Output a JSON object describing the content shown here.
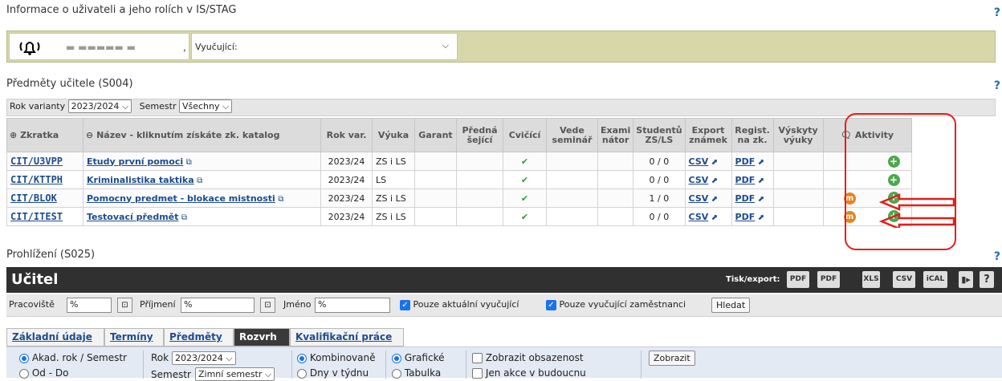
{
  "header": {
    "title": "Informace o uživateli a jeho rolích v IS/STAG",
    "user_name": "▬ ▬▬▬▬▬ ▬",
    "role_value": "Vyučující:"
  },
  "subjects": {
    "title": "Předměty učitele (S004)",
    "filters": {
      "year_label": "Rok varianty",
      "year_value": "2023/2024",
      "semester_label": "Semestr",
      "semester_value": "Všechny"
    },
    "columns": {
      "code": "Zkratka",
      "name": "Název - kliknutím získáte zk. katalog",
      "year": "Rok var.",
      "teaching": "Výuka",
      "guarantor": "Garant",
      "lecturer": "Předná šející",
      "exerciser": "Cvičící",
      "seminar": "Vede seminář",
      "examiner": "Exami nátor",
      "students": "Studentů ZS/LS",
      "export": "Export známek",
      "reg": "Regist. na zk.",
      "occurrences": "Výskyty výuky",
      "activities": "Aktivity"
    },
    "rows": [
      {
        "code": "CIT/U3VPP",
        "name": "Etudy první pomoci",
        "year": "2023/24",
        "teaching": "ZS i LS",
        "students": "0 / 0",
        "csv": "CSV",
        "pdf": "PDF",
        "activity": ""
      },
      {
        "code": "CIT/KTTPH",
        "name": "Kriminalistika taktika",
        "year": "2023/24",
        "teaching": "LS",
        "students": "0 / 0",
        "csv": "CSV",
        "pdf": "PDF",
        "activity": ""
      },
      {
        "code": "CIT/BLOK",
        "name": "Pomocny predmet - blokace mistnosti",
        "year": "2023/24",
        "teaching": "ZS i LS",
        "students": "1 / 0",
        "csv": "CSV",
        "pdf": "PDF",
        "activity": "m"
      },
      {
        "code": "CIT/ITEST",
        "name": "Testovací předmět",
        "year": "2023/24",
        "teaching": "ZS i LS",
        "students": "0 / 0",
        "csv": "CSV",
        "pdf": "PDF",
        "activity": "m"
      }
    ]
  },
  "browse": {
    "title": "Prohlížení (S025)",
    "bar_title": "Učitel",
    "print_label": "Tisk/export:",
    "export_icons": [
      "PDF",
      "PDF",
      "XLS",
      "CSV",
      "iCAL"
    ],
    "fields": {
      "workplace_label": "Pracoviště",
      "workplace_value": "%",
      "surname_label": "Příjmení",
      "surname_value": "%",
      "firstname_label": "Jméno",
      "firstname_value": "%",
      "only_current": "Pouze aktuální vyučující",
      "only_employees": "Pouze vyučující zaměstnanci",
      "search_button": "Hledat"
    },
    "tabs": [
      "Základní údaje",
      "Termíny",
      "Předměty",
      "Rozvrh",
      "Kvalifikační práce"
    ],
    "options": {
      "academic": "Akad. rok / Semestr",
      "fromto": "Od - Do",
      "year_label": "Rok",
      "year_value": "2023/2024",
      "semester_label": "Semestr",
      "semester_value": "Zimní semestr",
      "combined": "Kombinovaně",
      "days": "Dny v týdnu",
      "graphic": "Grafické",
      "table": "Tabulka",
      "show_occupancy": "Zobrazit obsazenost",
      "only_future": "Jen akce v budoucnu",
      "show_button": "Zobrazit"
    }
  }
}
